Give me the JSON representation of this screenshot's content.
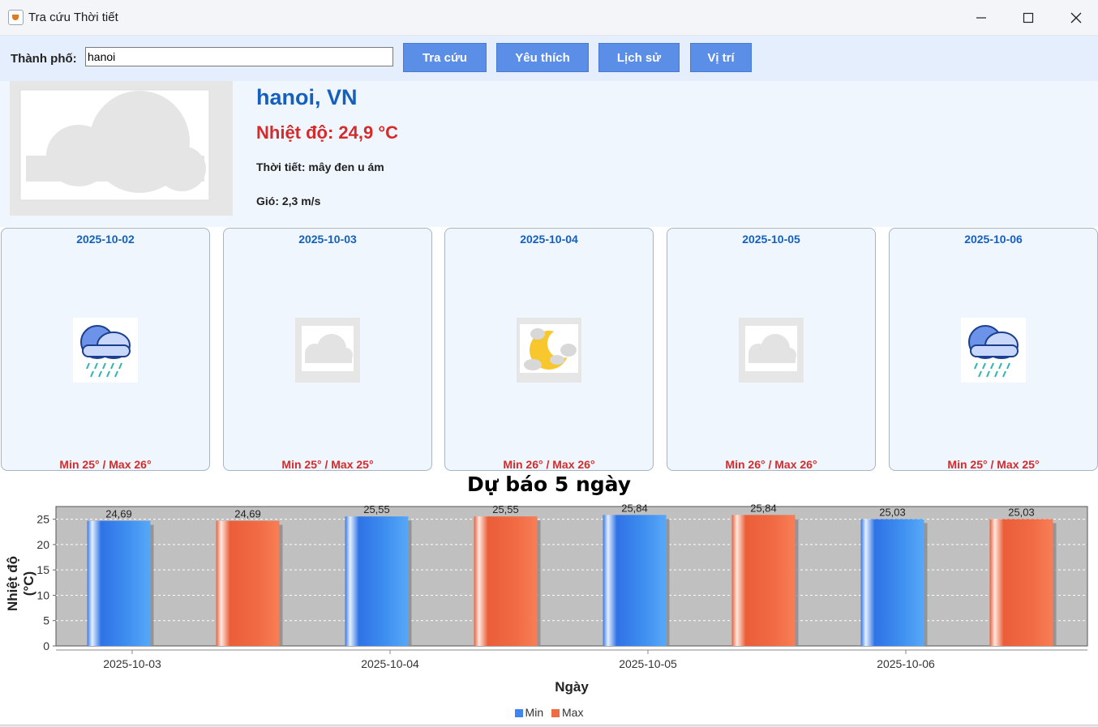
{
  "window": {
    "title": "Tra cứu Thời tiết"
  },
  "toolbar": {
    "city_label": "Thành phố:",
    "city_value": "hanoi",
    "buttons": {
      "search": "Tra cứu",
      "favorites": "Yêu thích",
      "history": "Lịch sử",
      "location": "Vị trí"
    }
  },
  "current": {
    "city": "hanoi, VN",
    "temperature": "Nhiệt độ: 24,9 °C",
    "weather": "Thời tiết: mây đen u ám",
    "wind": "Gió: 2,3 m/s",
    "icon": "overcast-cloud-icon"
  },
  "forecast": [
    {
      "date": "2025-10-02",
      "icon": "rain-cloud-icon",
      "minmax": "Min 25° / Max 26°"
    },
    {
      "date": "2025-10-03",
      "icon": "overcast-cloud-icon",
      "minmax": "Min 25° / Max 25°"
    },
    {
      "date": "2025-10-04",
      "icon": "night-partly-cloudy-icon",
      "minmax": "Min 26° / Max 26°"
    },
    {
      "date": "2025-10-05",
      "icon": "overcast-cloud-icon",
      "minmax": "Min 26° / Max 26°"
    },
    {
      "date": "2025-10-06",
      "icon": "rain-cloud-icon",
      "minmax": "Min 25° / Max 25°"
    }
  ],
  "colors": {
    "min": "#3f86f2",
    "max": "#f06a43",
    "plot_bg": "#c0c0c0",
    "accent_blue": "#1560bd",
    "accent_red": "#d52b2b"
  },
  "chart_data": {
    "type": "bar",
    "title": "Dự báo 5 ngày",
    "xlabel": "Ngày",
    "ylabel": "Nhiệt độ (°C)",
    "categories": [
      "2025-10-03",
      "2025-10-04",
      "2025-10-05",
      "2025-10-06"
    ],
    "series": [
      {
        "name": "Min",
        "values": [
          24.69,
          25.55,
          25.84,
          25.03
        ],
        "labels": [
          "24,69",
          "25,55",
          "25,84",
          "25,03"
        ]
      },
      {
        "name": "Max",
        "values": [
          24.69,
          25.55,
          25.84,
          25.03
        ],
        "labels": [
          "24,69",
          "25,55",
          "25,84",
          "25,03"
        ]
      }
    ],
    "yticks": [
      0,
      5,
      10,
      15,
      20,
      25
    ],
    "ylim": [
      0,
      27.5
    ],
    "grid": true,
    "legend": "bottom"
  }
}
